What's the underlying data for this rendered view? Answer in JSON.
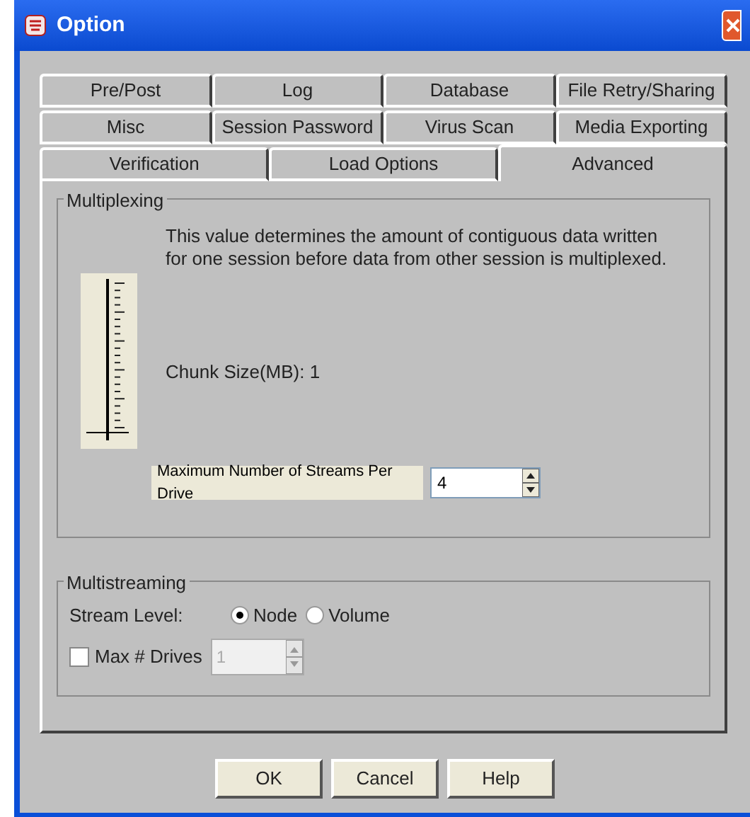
{
  "window": {
    "title": "Option"
  },
  "tab_rows": [
    [
      {
        "label": "Pre/Post",
        "selected": false
      },
      {
        "label": "Log",
        "selected": false
      },
      {
        "label": "Database",
        "selected": false
      },
      {
        "label": "File Retry/Sharing",
        "selected": false
      }
    ],
    [
      {
        "label": "Misc",
        "selected": false
      },
      {
        "label": "Session Password",
        "selected": false
      },
      {
        "label": "Virus Scan",
        "selected": false
      },
      {
        "label": "Media Exporting",
        "selected": false
      }
    ],
    [
      {
        "label": "Verification",
        "selected": false
      },
      {
        "label": "Load Options",
        "selected": false
      },
      {
        "label": "Advanced",
        "selected": true
      }
    ]
  ],
  "multiplexing": {
    "title": "Multiplexing",
    "slider": {
      "level": 0
    },
    "description": "This value determines the amount of contiguous data written for one session before data from other session is multiplexed.",
    "chunk_size": "Chunk Size(MB): 1",
    "streams_label": "Maximum Number of Streams Per Drive",
    "streams_value": "4"
  },
  "multistreaming": {
    "title": "Multistreaming",
    "stream_level_label": "Stream Level:",
    "options": [
      {
        "label": "Node",
        "selected": true
      },
      {
        "label": "Volume",
        "selected": false
      }
    ],
    "max_drives": {
      "label": "Max # Drives",
      "checked": false,
      "value": "1",
      "disabled": true
    }
  },
  "buttons": [
    "OK",
    "Cancel",
    "Help"
  ]
}
